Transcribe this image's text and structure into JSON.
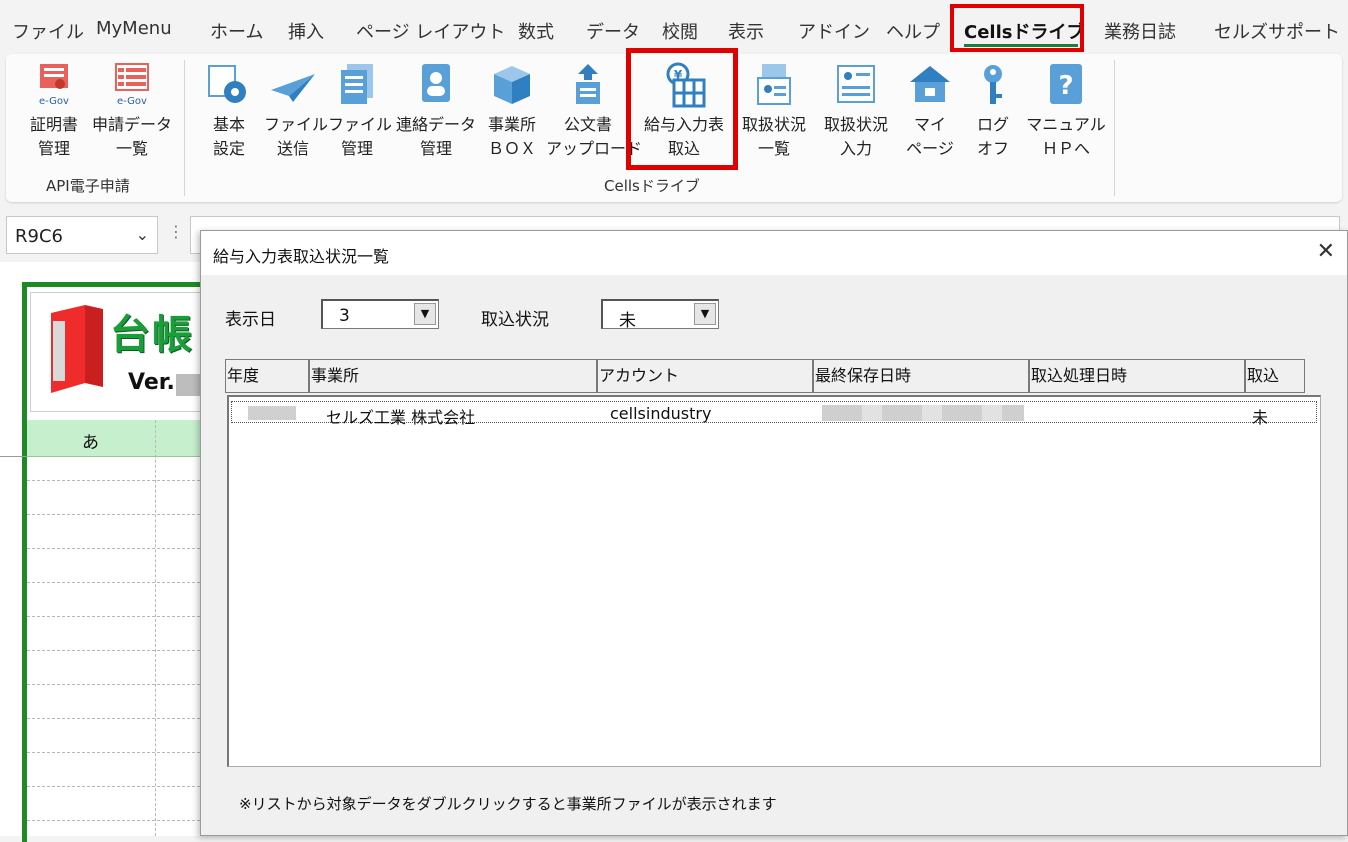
{
  "menu": {
    "tabs": [
      "ファイル",
      "MyMenu",
      "ホーム",
      "挿入",
      "ページ レイアウト",
      "数式",
      "データ",
      "校閲",
      "表示",
      "アドイン",
      "ヘルプ",
      "Cellsドライブ",
      "業務日誌",
      "セルズサポート"
    ],
    "active_tab": "Cellsドライブ"
  },
  "ribbon": {
    "group1": {
      "label": "API電子申請",
      "buttons": [
        {
          "line1": "証明書",
          "line2": "管理",
          "icon": "certificate-egov-icon"
        },
        {
          "line1": "申請データ",
          "line2": "一覧",
          "icon": "list-egov-icon"
        }
      ]
    },
    "group2": {
      "label": "Cellsドライブ",
      "buttons": [
        {
          "line1": "基本",
          "line2": "設定",
          "icon": "settings-gear-icon"
        },
        {
          "line1": "ファイル",
          "line2": "送信",
          "icon": "paper-plane-icon"
        },
        {
          "line1": "ファイル",
          "line2": "管理",
          "icon": "file-stack-icon"
        },
        {
          "line1": "連絡データ",
          "line2": "管理",
          "icon": "contact-book-icon"
        },
        {
          "line1": "事業所",
          "line2": "ＢＯＸ",
          "icon": "box-icon"
        },
        {
          "line1": "公文書",
          "line2": "アップロード",
          "icon": "upload-document-icon"
        },
        {
          "line1": "給与入力表",
          "line2": "取込",
          "icon": "yen-table-icon"
        },
        {
          "line1": "取扱状況",
          "line2": "一覧",
          "icon": "status-list-icon"
        },
        {
          "line1": "取扱状況",
          "line2": "入力",
          "icon": "status-input-icon"
        },
        {
          "line1": "マイ",
          "line2": "ページ",
          "icon": "home-icon"
        },
        {
          "line1": "ログ",
          "line2": "オフ",
          "icon": "key-icon"
        },
        {
          "line1": "マニュアル",
          "line2": "ＨＰへ",
          "icon": "help-manual-icon"
        }
      ]
    }
  },
  "formula_bar": {
    "name_box": "R9C6",
    "dots": "⋮"
  },
  "sheet": {
    "logo_text": "台帳",
    "version_prefix": "Ver.",
    "column_header": "あ"
  },
  "dialog": {
    "title": "給与入力表取込状況一覧",
    "close_glyph": "✕",
    "date_label": "表示日",
    "date_value": "3",
    "status_label": "取込状況",
    "status_value": "未",
    "columns": [
      "年度",
      "事業所",
      "アカウント",
      "最終保存日時",
      "取込処理日時",
      "取込"
    ],
    "rows": [
      {
        "year": "",
        "office": "セルズ工業  株式会社",
        "account": "cellsindustry",
        "saved": "",
        "imported": "",
        "status": "未"
      }
    ],
    "note": "※リストから対象データをダブルクリックすると事業所ファイルが表示されます"
  },
  "colors": {
    "accent_red": "#e00000",
    "excel_green": "#1a7f3c",
    "sheet_green": "#1e8a25"
  }
}
